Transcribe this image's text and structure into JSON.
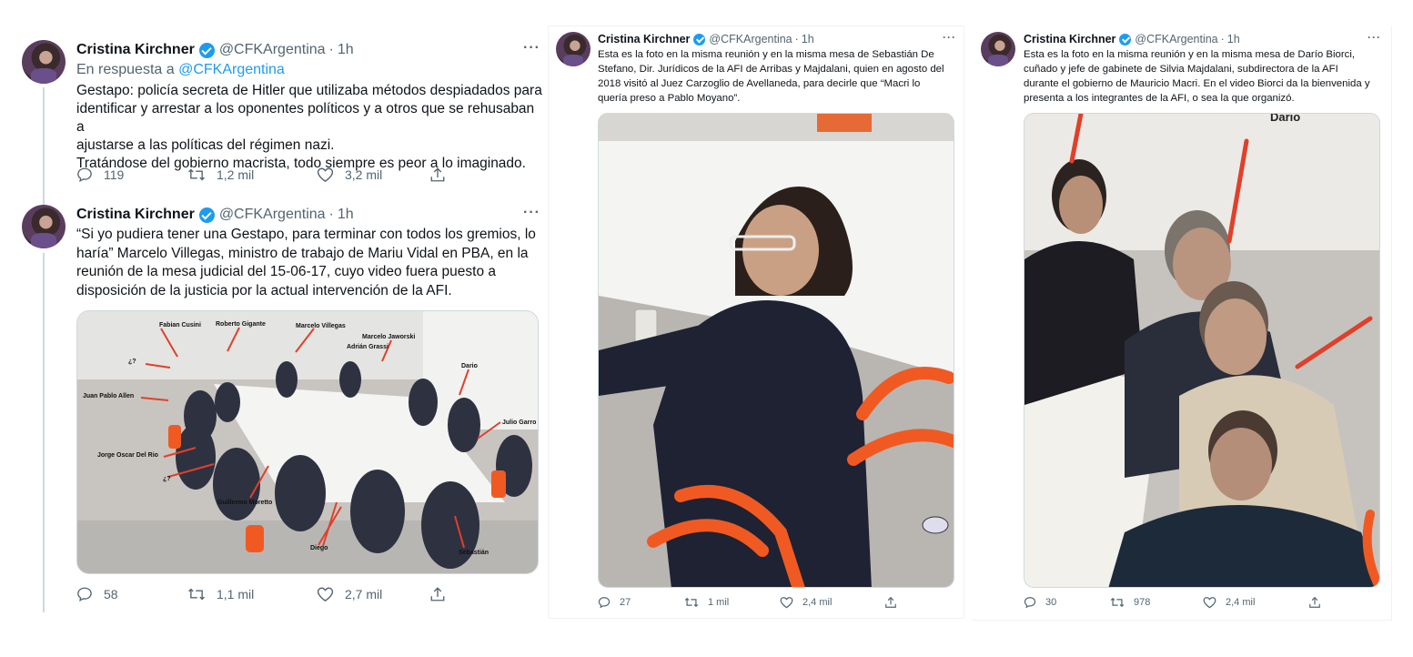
{
  "tweet1": {
    "name": "Cristina Kirchner",
    "handle": "@CFKArgentina",
    "time": "1h",
    "reply_prefix": "En respuesta a",
    "reply_handle": "@CFKArgentina",
    "text_lines": [
      "Gestapo: policía secreta de Hitler que utilizaba métodos despiadados para",
      "identificar y arrestar a los oponentes políticos y a otros que se rehusaban a",
      "ajustarse a las políticas del régimen nazi.",
      "Tratándose del gobierno macrista, todo siempre es peor a lo imaginado."
    ],
    "replies": "119",
    "retweets": "1,2 mil",
    "likes": "3,2 mil"
  },
  "tweet2": {
    "name": "Cristina Kirchner",
    "handle": "@CFKArgentina",
    "time": "1h",
    "text_lines": [
      "“Si yo pudiera tener una Gestapo, para terminar con todos los gremios, lo",
      "haría” Marcelo Villegas, ministro de trabajo de Mariu Vidal en PBA, en la",
      "reunión de la mesa judicial del 15-06-17, cuyo video fuera puesto a",
      "disposición de la justicia por la actual intervención de la AFI."
    ],
    "photo_labels": [
      "Fabian Cusini",
      "Roberto Gigante",
      "Marcelo Villegas",
      "Marcelo Jaworski",
      "Adrián Grassi",
      "¿?",
      "Dario",
      "Juan Pablo Allen",
      "Julio Garro",
      "Jorge Oscar Del Rio",
      "¿?",
      "Guillermo Moretto",
      "Diego",
      "Sebastián"
    ],
    "replies": "58",
    "retweets": "1,1 mil",
    "likes": "2,7 mil"
  },
  "tweet3": {
    "name": "Cristina Kirchner",
    "handle": "@CFKArgentina",
    "time": "1h",
    "text_lines": [
      "Esta es la foto en la misma reunión y en la misma mesa de Sebastián De",
      "Stefano, Dir. Jurídicos de la AFI de Arribas y Majdalani, quien en agosto del",
      "2018 visitó al Juez Carzoglio de Avellaneda, para decirle que “Macri lo",
      "quería preso a Pablo Moyano”."
    ],
    "replies": "27",
    "retweets": "1 mil",
    "likes": "2,4 mil"
  },
  "tweet4": {
    "name": "Cristina Kirchner",
    "handle": "@CFKArgentina",
    "time": "1h",
    "text_lines": [
      "Esta es la foto en la misma reunión y en la misma mesa de Darío Biorci,",
      "cuñado y jefe de gabinete de Silvia Majdalani, subdirectora de la AFI",
      "durante el gobierno de Mauricio Macri. En el video Biorci da la bienvenida y",
      "presenta a los integrantes de la AFI, o sea la que organizó."
    ],
    "photo_label": "Dario",
    "replies": "30",
    "retweets": "978",
    "likes": "2,4 mil"
  },
  "colors": {
    "accent": "#1d9bf0",
    "muted": "#536471",
    "annotation": "#e0402a",
    "chair": "#f05a22"
  }
}
